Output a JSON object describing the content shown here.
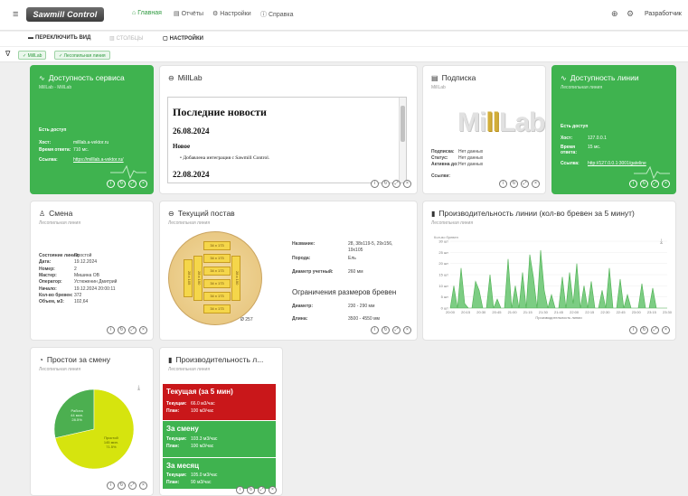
{
  "app": {
    "logo": "Sawmill Control",
    "user": "Разработчик"
  },
  "nav": {
    "home": "Главная",
    "reports": "Отчёты",
    "settings": "Настройки",
    "help": "Справка"
  },
  "toolbar": {
    "switch_view": "ПЕРЕКЛЮЧИТЬ ВИД",
    "columns": "СТОЛБЦЫ",
    "settings": "НАСТРОЙКИ"
  },
  "filters": [
    "MillLab",
    "Лесопильная линия"
  ],
  "service": {
    "title": "Доступность сервиса",
    "subtitle": "MillLab - MillLab",
    "status": "Есть доступ",
    "host_label": "Хост:",
    "host": "milllab.a-vektor.ru",
    "resp_label": "Время ответа:",
    "resp": "710 мс.",
    "link_label": "Ссылка:",
    "link": "https://milllab.a-vektor.ru/"
  },
  "milllab": {
    "title": "MillLab",
    "news_title": "Последние новости",
    "date1": "26.08.2024",
    "new_label": "Новое",
    "item": "Добавлена интеграция с Sawmill Control.",
    "date2": "22.08.2024"
  },
  "subscription": {
    "title": "Подписка",
    "subtitle": "MillLab",
    "logo_a": "Mi",
    "logo_b": "ll",
    "logo_c": "Lab",
    "sub_label": "Подписка:",
    "sub": "Нет данных",
    "status_label": "Статус:",
    "status": "Нет данных",
    "active_label": "Активна до:",
    "active": "Нет данных",
    "link_label": "Ссылки:"
  },
  "line": {
    "title": "Доступность линии",
    "subtitle": "Лесопильная линия",
    "status": "Есть доступ",
    "host_label": "Хост:",
    "host": "127.0.0.1",
    "resp_label": "Время ответа:",
    "resp": "15 мс.",
    "link_label": "Ссылка:",
    "link": "http://127.0.0.1:3001/gateline"
  },
  "shift": {
    "title": "Смена",
    "subtitle": "Лесопильная линия",
    "rows": [
      [
        "Состояние линии:",
        "Простой"
      ],
      [
        "Дата:",
        "19.12.2024"
      ],
      [
        "Номер:",
        "2"
      ],
      [
        "Мастер:",
        "Мишина ОВ"
      ],
      [
        "Оператор:",
        "Устюженин Дмитрий"
      ],
      [
        "Начало:",
        "19.12.2024 20:00:11"
      ],
      [
        "Кол-во бревен:",
        "372"
      ],
      [
        "Объем, м3:",
        "102,64"
      ]
    ]
  },
  "post": {
    "title": "Текущий постав",
    "subtitle": "Лесопильная линия",
    "boards": [
      "34 x 173",
      "34 x 173",
      "34 x 173",
      "34 x 173",
      "34 x 173",
      "34 x 173"
    ],
    "side_left_a": "28 x 105",
    "side_left_b": "28 x 150",
    "side_right": "28 x 150",
    "diameter_mark": "Ø 257",
    "name_label": "Название:",
    "name_1": "28, 38x119-5, 29x156,",
    "name_2": "19x105",
    "species_label": "Порода:",
    "species": "Ель",
    "diam_label": "Диаметр учетный:",
    "diam": "260 мм",
    "limits_title": "Ограничения размеров бревен",
    "ldiam_label": "Диаметр:",
    "ldiam": "230 - 290 мм",
    "llen_label": "Длина:",
    "llen": "3500 - 4550 мм"
  },
  "productivity": {
    "title": "Производительность линии (кол-во бревен за 5 минут)",
    "subtitle": "Лесопильная линия"
  },
  "chart_data": [
    {
      "type": "area",
      "title": "",
      "ylabel": "Кол-во бревен",
      "xlabel": "Производительность линии",
      "ylim": [
        0,
        30
      ],
      "yticks": [
        "0 шт",
        "5 шт",
        "10 шт",
        "15 шт",
        "20 шт",
        "25 шт",
        "30 шт"
      ],
      "x": [
        "20:00",
        "20:15",
        "20:30",
        "20:45",
        "21:00",
        "21:15",
        "21:30",
        "21:45",
        "22:00",
        "22:15",
        "22:30",
        "22:45",
        "23:00",
        "23:15",
        "23:30"
      ],
      "series": [
        {
          "values": [
            0,
            10,
            0,
            18,
            2,
            0,
            0,
            12,
            8,
            0,
            0,
            15,
            0,
            4,
            0,
            0,
            22,
            0,
            10,
            0,
            16,
            0,
            24,
            14,
            0,
            26,
            8,
            0,
            6,
            0,
            0,
            14,
            0,
            16,
            2,
            20,
            0,
            10,
            0,
            12,
            0,
            0,
            8,
            0,
            18,
            0,
            0,
            13,
            0,
            6,
            0,
            0,
            0,
            11,
            0,
            0,
            9,
            0,
            0,
            0,
            0
          ]
        }
      ],
      "color": "#4caf50"
    },
    {
      "type": "pie",
      "title": "",
      "series": [
        {
          "name": "Работа",
          "value": 44,
          "value_label": "44 мин.",
          "pct": "28.5%",
          "color": "#4caf50"
        },
        {
          "name": "Простой",
          "value": 110,
          "value_label": "145 мин.",
          "pct": "71.5%",
          "color": "#d6e40e"
        }
      ]
    }
  ],
  "downtime": {
    "title": "Простои за смену",
    "subtitle": "Лесопильная линия"
  },
  "productivity2": {
    "title": "Производительность л...",
    "subtitle": "Лесопильная линия",
    "cur_label": "Текущая:",
    "plan_label": "План:",
    "blocks": [
      {
        "title": "Текущая (за 5 мин)",
        "cur": "66.0 м3/час",
        "plan": "100 м3/час",
        "color": "#c9171a"
      },
      {
        "title": "За смену",
        "cur": "103.3 м3/час",
        "plan": "100 м3/час",
        "color": "#3fb34f"
      },
      {
        "title": "За месяц",
        "cur": "105.0 м3/час",
        "plan": "90 м3/час",
        "color": "#3fb34f"
      }
    ]
  },
  "icons": {
    "controls": [
      "info-icon",
      "refresh-icon",
      "expand-icon",
      "close-icon"
    ]
  }
}
